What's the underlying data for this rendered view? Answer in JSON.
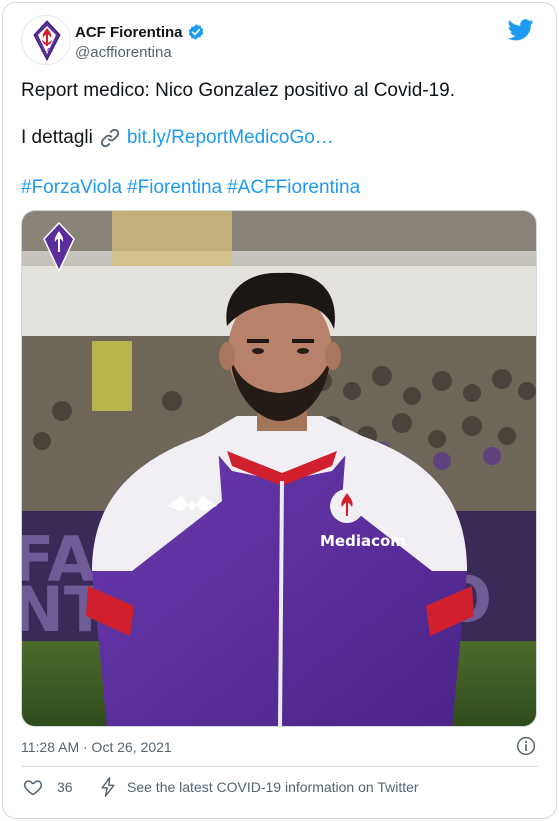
{
  "author": {
    "display_name": "ACF Fiorentina",
    "handle": "@acffiorentina",
    "verified": true,
    "avatar_icon": "fiorentina-crest-icon"
  },
  "tweet": {
    "line1": "Report medico: Nico Gonzalez positivo al Covid-19.",
    "details_label": "I dettagli",
    "link_text": "bit.ly/ReportMedicoGo…",
    "hashtags": [
      "#ForzaViola",
      "#Fiorentina",
      "#ACFFiorentina"
    ]
  },
  "media": {
    "kit_sponsor": "Mediacom",
    "icon": "fiorentina-crest-icon"
  },
  "footer": {
    "timestamp": "11:28 AM · Oct 26, 2021",
    "like_count": "36",
    "covid_notice": "See the latest COVID-19 information on Twitter"
  },
  "colors": {
    "link": "#1d9bf0",
    "text": "#0f1419",
    "secondary": "#536471",
    "fiorentina_purple": "#5a2d9c"
  }
}
